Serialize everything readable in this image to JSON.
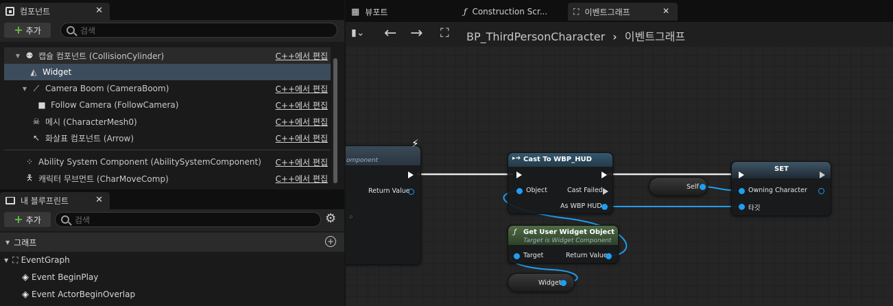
{
  "components_panel": {
    "tab_label": "컴포넌트",
    "add_label": "추가",
    "search_placeholder": "검색",
    "cpp_link": "C++에서 편집",
    "items": [
      {
        "label": "캡슐 컴포넌트 (CollisionCylinder)",
        "icon": "capsule-icon",
        "has_link": true
      },
      {
        "label": "Widget",
        "icon": "widget-icon",
        "has_link": false
      },
      {
        "label": "Camera Boom (CameraBoom)",
        "icon": "spring-arm-icon",
        "has_link": true
      },
      {
        "label": "Follow Camera (FollowCamera)",
        "icon": "camera-icon",
        "has_link": true
      },
      {
        "label": "메시 (CharacterMesh0)",
        "icon": "skeleton-icon",
        "has_link": true
      },
      {
        "label": "화살표 컴포넌트 (Arrow)",
        "icon": "arrow-icon",
        "has_link": true
      },
      {
        "label": "Ability System Component (AbilitySystemComponent)",
        "icon": "dots-icon",
        "has_link": true
      },
      {
        "label": "캐릭터 무브먼트 (CharMoveComp)",
        "icon": "movement-icon",
        "has_link": true
      }
    ]
  },
  "blueprint_panel": {
    "tab_label": "내 블루프린트",
    "add_label": "추가",
    "search_placeholder": "검색",
    "section_graph": "그래프",
    "items": [
      {
        "label": "EventGraph",
        "icon": "graph-icon"
      },
      {
        "label": "Event BeginPlay",
        "icon": "event-icon"
      },
      {
        "label": "Event ActorBeginOverlap",
        "icon": "event-icon"
      }
    ]
  },
  "editor_tabs": [
    {
      "label": "뷰포트",
      "icon": "viewport-icon"
    },
    {
      "label": "Construction Scr...",
      "icon": "function-icon"
    },
    {
      "label": "이벤트그래프",
      "icon": "graph-icon"
    }
  ],
  "breadcrumb": {
    "blueprint": "BP_ThirdPersonCharacter",
    "separator": "›",
    "graph": "이벤트그래프"
  },
  "nodes": {
    "left_node": {
      "subtitle": "omponent",
      "pin_return": "Return Value"
    },
    "cast": {
      "title": "Cast To WBP_HUD",
      "pin_object": "Object",
      "pin_cast_failed": "Cast Failed",
      "pin_as": "As WBP HUD"
    },
    "self": {
      "label": "Self"
    },
    "set": {
      "title": "SET",
      "pin_owning": "Owning Character",
      "pin_target": "타깃"
    },
    "get_widget": {
      "title": "Get User Widget Object",
      "subtitle": "Target is Widget Component",
      "pin_target": "Target",
      "pin_return": "Return Value"
    },
    "widget_var": {
      "label": "Widget"
    }
  },
  "colors": {
    "accent_blue": "#1f9ef0",
    "selected_row": "#3d4c5c",
    "cast_header": "#2f4a5c",
    "func_header": "#3f5a3a",
    "add_plus": "#5fbf3a"
  }
}
